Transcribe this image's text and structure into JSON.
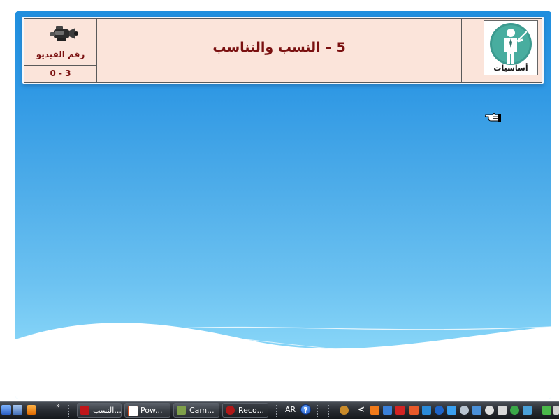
{
  "slide": {
    "title": "5 – النسب والتناسب",
    "video_label": "رقم الفيديو",
    "video_number": "0 - 3",
    "badge_label": "أساسيات",
    "icons": {
      "camera": "video-camera-icon",
      "teacher": "teacher-with-pointer-icon",
      "cursor": "hand-pointer-cursor"
    },
    "colors": {
      "title": "#7a1010",
      "panel_fill": "#fbe4da",
      "background_top": "#1f8ede",
      "background_bottom": "#8fd9f8"
    }
  },
  "taskbar": {
    "chevron": "»",
    "buttons": [
      {
        "label": "النسب...",
        "icon": "pdf-icon"
      },
      {
        "label": "Pow...",
        "icon": "powerpoint-icon"
      },
      {
        "label": "Cam...",
        "icon": "camtasia-icon"
      },
      {
        "label": "Reco...",
        "icon": "recorder-icon"
      }
    ],
    "language": "AR",
    "help": "?",
    "tray_arrow": "<"
  }
}
